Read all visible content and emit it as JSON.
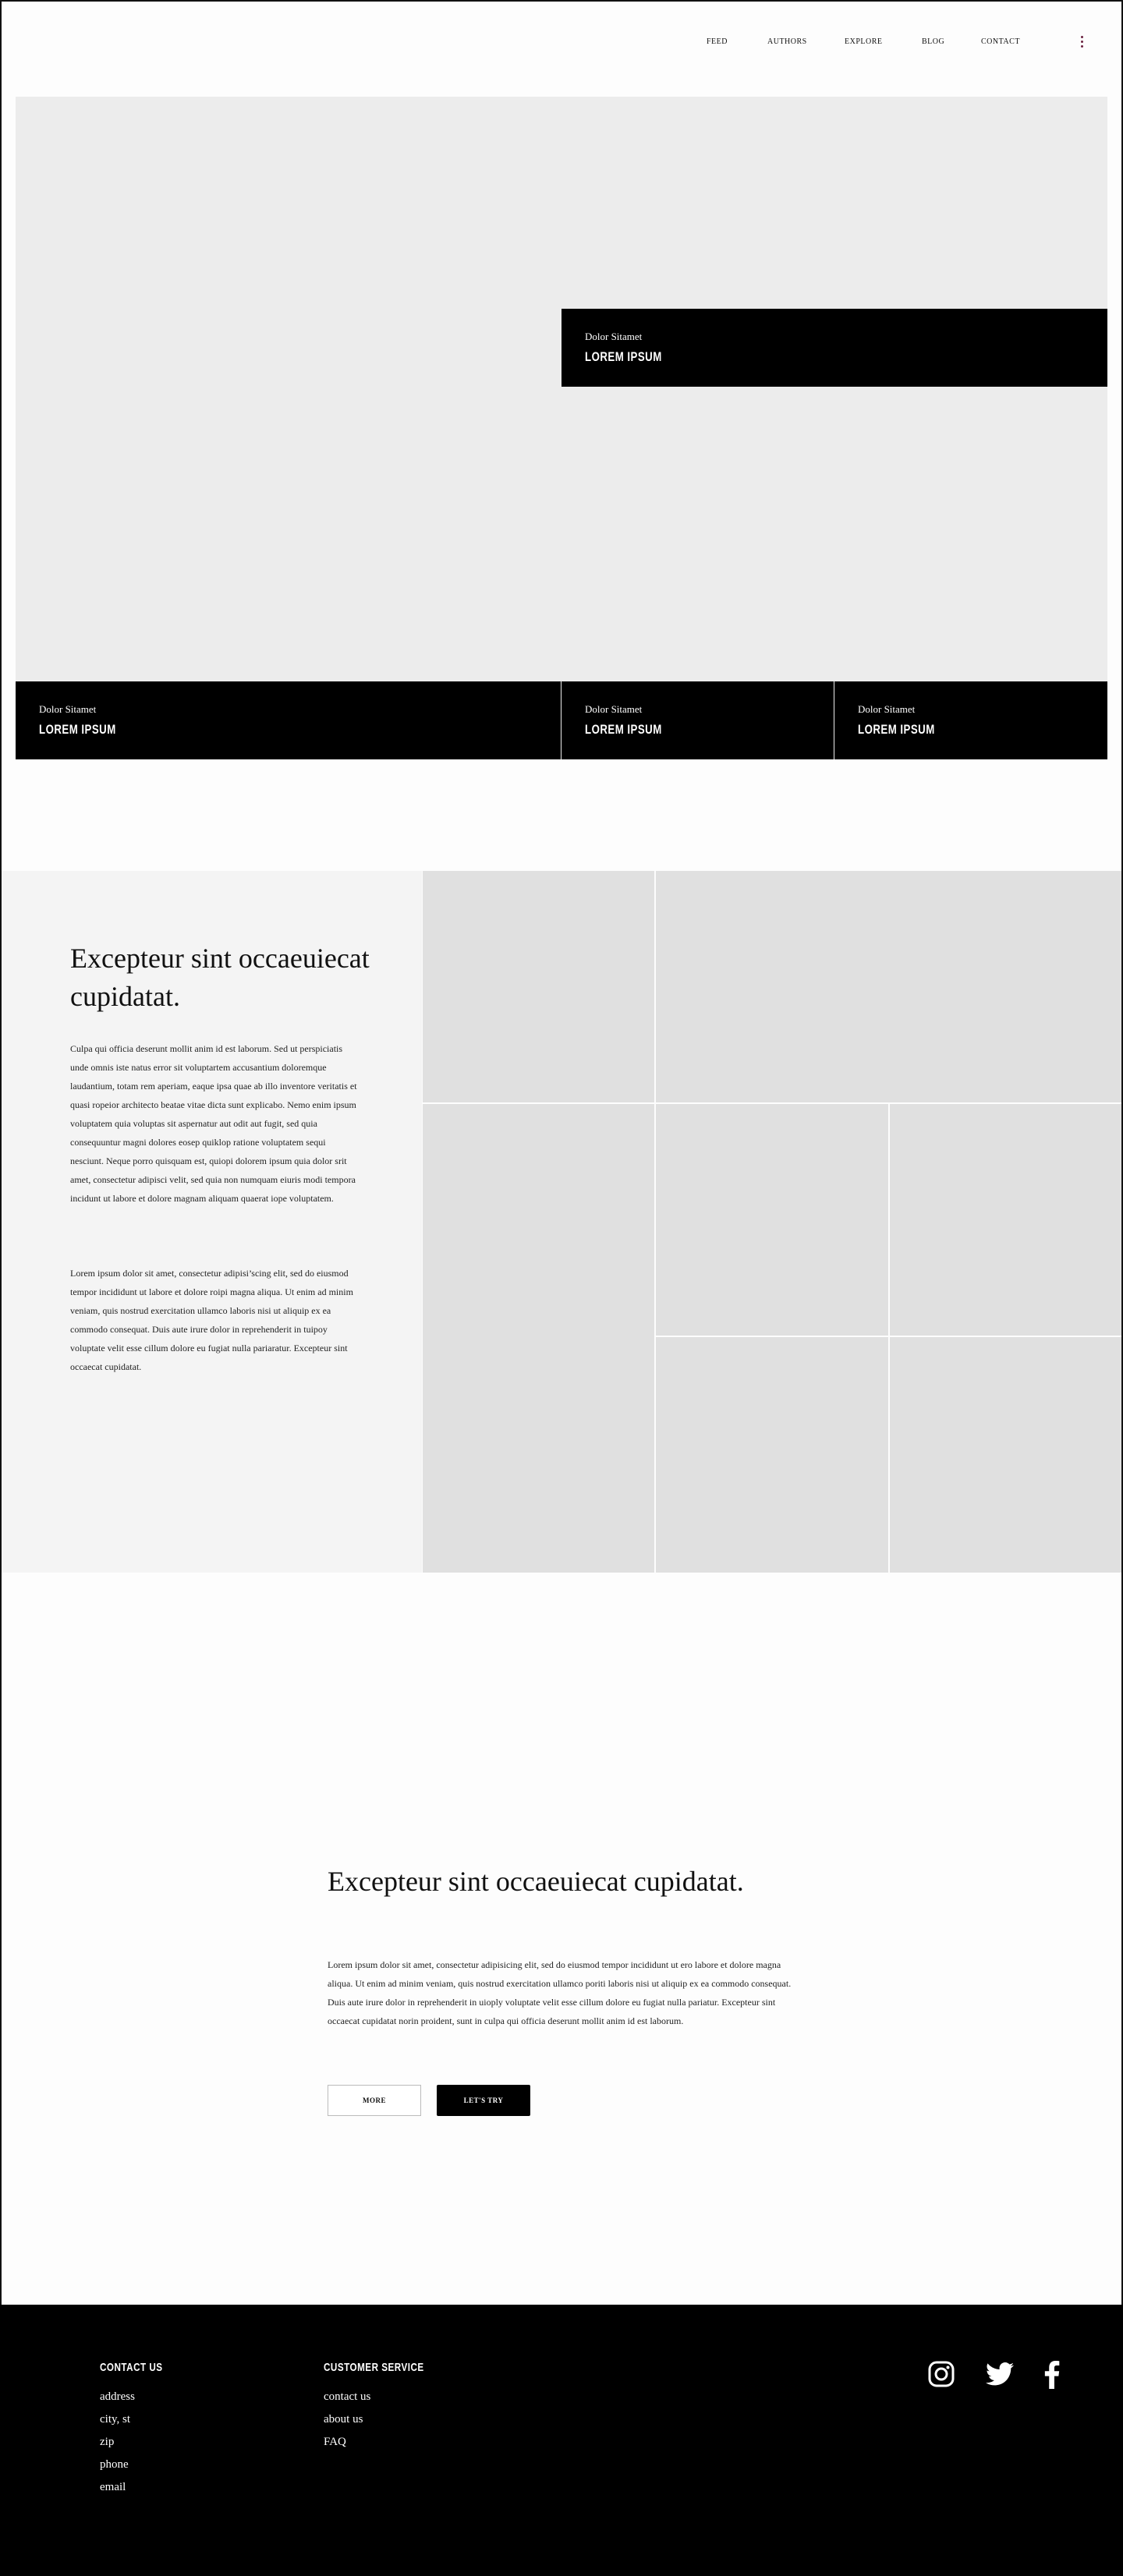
{
  "nav": {
    "links": [
      "FEED",
      "AUTHORS",
      "EXPLORE",
      "BLOG",
      "CONTACT"
    ]
  },
  "hero": {
    "feature": {
      "subtitle": "Dolor Sitamet",
      "title": "LOREM IPSUM"
    },
    "cards": [
      {
        "subtitle": "Dolor Sitamet",
        "title": "LOREM IPSUM"
      },
      {
        "subtitle": "Dolor Sitamet",
        "title": "LOREM IPSUM"
      },
      {
        "subtitle": "Dolor Sitamet",
        "title": "LOREM IPSUM"
      }
    ]
  },
  "section2": {
    "heading": "Excepteur sint occaeuiecat cupidatat.",
    "paragraph1": "Culpa qui officia deserunt mollit anim id est laborum. Sed ut perspiciatis unde omnis iste natus error sit voluptartem accusantium doloremque laudantium, totam rem aperiam, eaque ipsa quae ab illo inventore veritatis et quasi ropeior architecto beatae vitae dicta sunt explicabo. Nemo enim ipsum voluptatem quia voluptas sit aspernatur aut odit aut fugit, sed quia consequuntur magni dolores eosep quiklop ratione voluptatem sequi nesciunt. Neque porro quisquam est, quiopi dolorem ipsum quia dolor srit amet, consectetur adipisci velit, sed quia non numquam eiuris modi tempora incidunt ut labore et dolore magnam aliquam quaerat iope voluptatem.",
    "paragraph2": "Lorem ipsum dolor sit amet, consectetur adipisi’scing elit, sed do eiusmod tempor incididunt ut labore et dolore roipi magna aliqua. Ut enim ad minim veniam, quis nostrud exercitation ullamco laboris nisi ut aliquip ex ea commodo consequat. Duis aute irure dolor in reprehenderit in tuipoy voluptate velit esse cillum dolore eu fugiat nulla pariaratur. Excepteur sint occaecat cupidatat."
  },
  "section3": {
    "heading": "Excepteur sint occaeuiecat cupidatat.",
    "paragraph": "Lorem ipsum dolor sit amet, consectetur adipisicing elit, sed do eiusmod tempor incididunt ut ero labore et dolore magna aliqua. Ut enim ad minim veniam, quis nostrud exercitation ullamco poriti laboris nisi ut aliquip ex ea commodo consequat. Duis aute irure dolor in reprehenderit in uioply voluptate velit esse cillum dolore eu fugiat nulla pariatur. Excepteur sint occaecat cupidatat norin proident, sunt in culpa qui officia deserunt mollit anim id est laborum.",
    "more_label": "MORE",
    "try_label": "LET'S TRY"
  },
  "footer": {
    "contact_heading": "CONTACT US",
    "contact_items": [
      "address",
      "city, st",
      "zip",
      "phone",
      "email"
    ],
    "service_heading": "CUSTOMER SERVICE",
    "service_items": [
      "contact us",
      "about us",
      "FAQ"
    ],
    "social_icons": [
      "instagram-icon",
      "twitter-icon",
      "facebook-icon"
    ]
  },
  "colors": {
    "hero_bg": "#ececec",
    "tile_bg": "#e0e0e0",
    "panel_bg": "#f4f4f4",
    "footer_bg": "#000000",
    "kebab_accent": "#6b2340"
  }
}
